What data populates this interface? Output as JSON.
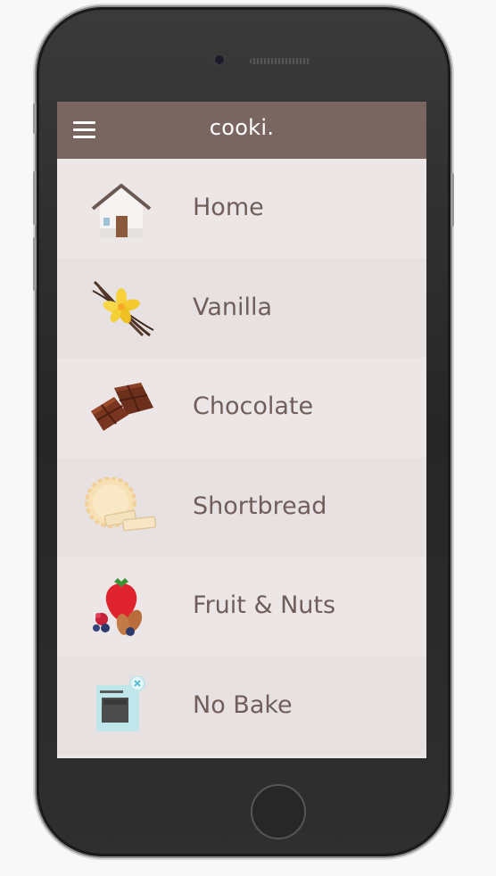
{
  "app": {
    "title": "cooki."
  },
  "menu": {
    "items": [
      {
        "label": "Home",
        "icon": "house-icon"
      },
      {
        "label": "Vanilla",
        "icon": "vanilla-icon"
      },
      {
        "label": "Chocolate",
        "icon": "chocolate-icon"
      },
      {
        "label": "Shortbread",
        "icon": "shortbread-icon"
      },
      {
        "label": "Fruit & Nuts",
        "icon": "fruit-nuts-icon"
      },
      {
        "label": "No Bake",
        "icon": "oven-icon"
      }
    ]
  },
  "colors": {
    "app_bar": "#7a6661",
    "screen_bg": "#ece6e7",
    "row_alt_bg": "#e8e1e2",
    "label_text": "#6f5e59"
  }
}
